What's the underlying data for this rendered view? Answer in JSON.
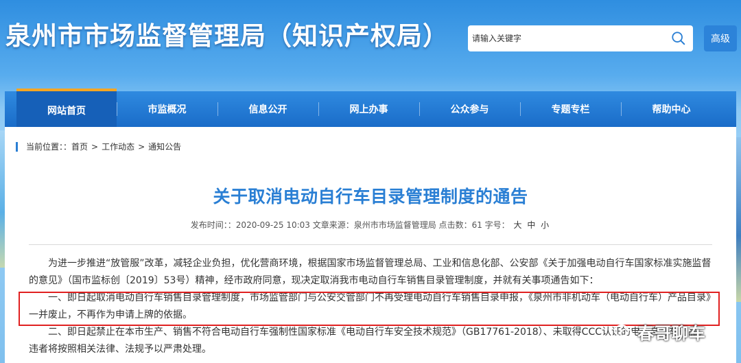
{
  "header": {
    "site_title": "泉州市市场监督管理局（知识产权局）",
    "search_placeholder": "请输入关键字",
    "advanced_label": "高级"
  },
  "nav": {
    "items": [
      {
        "label": "网站首页",
        "active": true
      },
      {
        "label": "市监概况"
      },
      {
        "label": "信息公开"
      },
      {
        "label": "网上办事"
      },
      {
        "label": "公众参与"
      },
      {
        "label": "专题专栏"
      },
      {
        "label": "帮助中心"
      }
    ]
  },
  "breadcrumb": {
    "prefix": "当前位置：：",
    "items": [
      "首页",
      "工作动态",
      "通知公告"
    ],
    "separator": ">"
  },
  "article": {
    "title": "关于取消电动自行车目录管理制度的通告",
    "meta_prefix": "发布时间：：2020-09-25 10:03 文章来源：泉州市市场监督管理局 点击数：61 字号：",
    "font_sizes": [
      "大",
      "中",
      "小"
    ],
    "paragraphs": [
      "为进一步推进“放管服”改革，减轻企业负担，优化营商环境，根据国家市场监督管理总局、工业和信息化部、公安部《关于加强电动自行车国家标准实施监督的意见》（国市监标创〔2019〕53号）精神，经市政府同意，现决定取消我市电动自行车销售目录管理制度，并就有关事项通告如下：",
      "一、即日起取消电动自行车销售目录管理制度，市场监管部门与公安交管部门不再受理电动自行车销售目录申报，《泉州市非机动车（电动自行车）产品目录》一并废止，不再作为申请上牌的依据。",
      "二、即日起禁止在本市生产、销售不符合电动自行车强制性国家标准《电动自行车安全技术规范》（GB17761-2018）、未取得CCC认证的电动自行车产品。违者将按照相关法律、法规予以严肃处理。"
    ]
  },
  "watermark": {
    "text": "春哥聊车",
    "icon": "wechat-icon"
  },
  "colors": {
    "accent": "#2a7fd4",
    "nav_active_border": "#f5a623",
    "highlight_border": "#e02020"
  }
}
